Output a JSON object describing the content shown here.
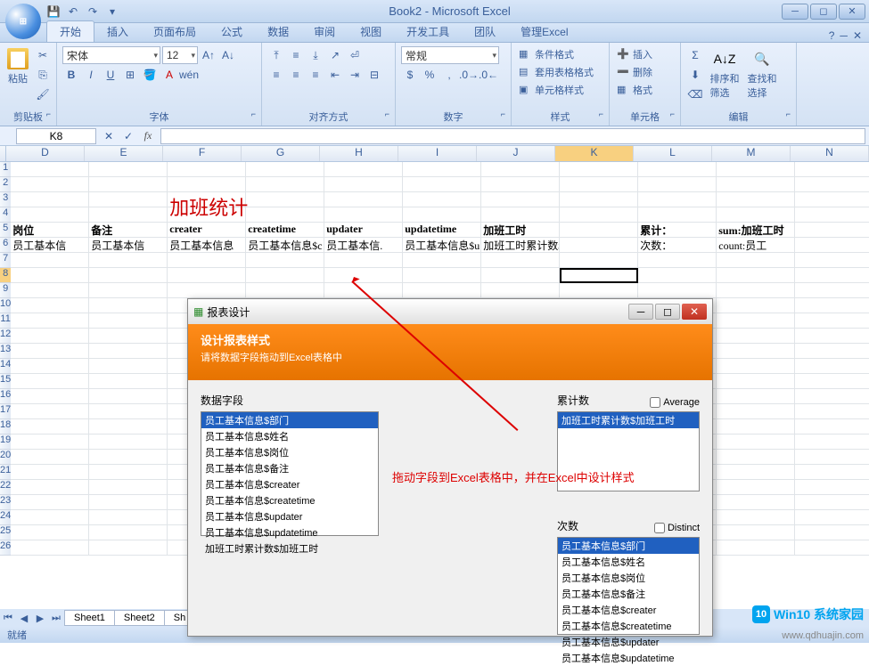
{
  "titlebar": {
    "title": "Book2 - Microsoft Excel"
  },
  "tabs": {
    "items": [
      "开始",
      "插入",
      "页面布局",
      "公式",
      "数据",
      "审阅",
      "视图",
      "开发工具",
      "团队",
      "管理Excel"
    ],
    "active": 0
  },
  "ribbon": {
    "clipboard": {
      "label": "剪贴板",
      "paste": "粘贴"
    },
    "font": {
      "label": "字体",
      "name": "宋体",
      "size": "12"
    },
    "align": {
      "label": "对齐方式"
    },
    "number": {
      "label": "数字",
      "format": "常规"
    },
    "styles": {
      "label": "样式",
      "cond": "条件格式",
      "table": "套用表格格式",
      "cell": "单元格样式"
    },
    "cells": {
      "label": "单元格",
      "insert": "插入",
      "delete": "删除",
      "format": "格式"
    },
    "editing": {
      "label": "编辑",
      "sort": "排序和\n筛选",
      "find": "查找和\n选择"
    }
  },
  "namebox": "K8",
  "grid": {
    "cols": [
      "D",
      "E",
      "F",
      "G",
      "H",
      "I",
      "J",
      "K",
      "L",
      "M",
      "N"
    ],
    "rows": [
      "1",
      "2",
      "3",
      "4",
      "5",
      "6",
      "7",
      "8",
      "9",
      "10",
      "11",
      "12",
      "13",
      "14",
      "15",
      "16",
      "17",
      "18",
      "19",
      "20",
      "21",
      "22",
      "23",
      "24",
      "25",
      "26"
    ],
    "reportTitle": "加班统计",
    "headerRow": [
      "岗位",
      "备注",
      "creater",
      "createtime",
      "updater",
      "updatetime",
      "加班工时",
      "",
      "累计：",
      "sum:加班工时"
    ],
    "dataRow": [
      "员工基本信",
      "员工基本信",
      "员工基本信息",
      "员工基本信息$c",
      "员工基本信.",
      "员工基本信息$u",
      "加班工时累计数$加班工时",
      "",
      "次数：",
      "count:员工"
    ],
    "activeCol": "K",
    "activeRow": "8"
  },
  "sheets": [
    "Sheet1",
    "Sheet2",
    "Sh"
  ],
  "statusbar": "就绪",
  "dialog": {
    "title": "报表设计",
    "header1": "设计报表样式",
    "header2": "请将数据字段拖动到Excel表格中",
    "dataFieldsLabel": "数据字段",
    "dataFields": [
      "员工基本信息$部门",
      "员工基本信息$姓名",
      "员工基本信息$岗位",
      "员工基本信息$备注",
      "员工基本信息$creater",
      "员工基本信息$createtime",
      "员工基本信息$updater",
      "员工基本信息$updatetime",
      "加班工时累计数$加班工时"
    ],
    "sumLabel": "累计数",
    "avgLabel": "Average",
    "sumFields": [
      "加班工时累计数$加班工时"
    ],
    "countLabel": "次数",
    "distinctLabel": "Distinct",
    "countFields": [
      "员工基本信息$部门",
      "员工基本信息$姓名",
      "员工基本信息$岗位",
      "员工基本信息$备注",
      "员工基本信息$creater",
      "员工基本信息$createtime",
      "员工基本信息$updater",
      "员工基本信息$updatetime"
    ]
  },
  "annotation": "拖动字段到Excel表格中，并在Excel中设计样式",
  "watermark": "www.qdhuajin.com",
  "win10": "Win10 系统家园"
}
